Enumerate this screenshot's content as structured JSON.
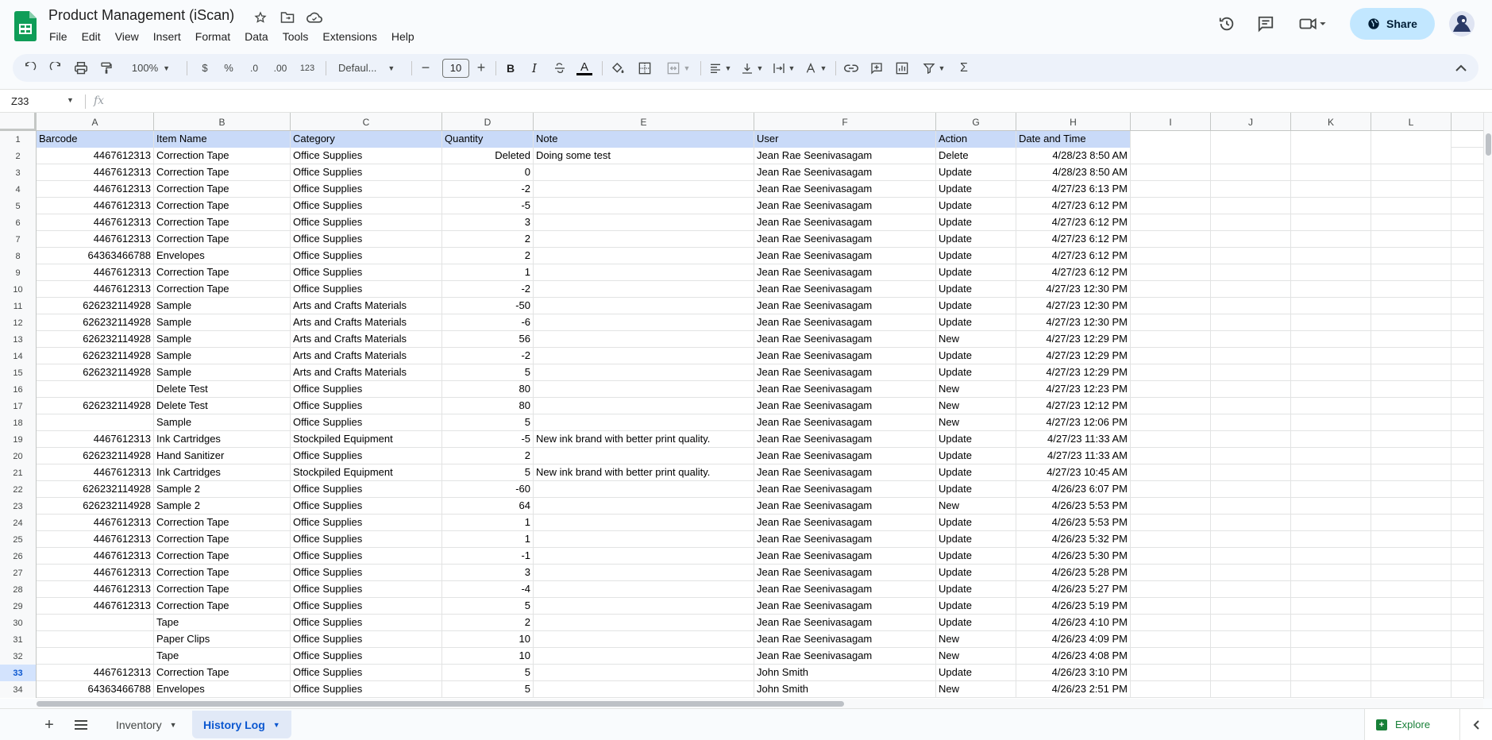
{
  "app": {
    "title": "Product Management (iScan)",
    "menu": [
      "File",
      "Edit",
      "View",
      "Insert",
      "Format",
      "Data",
      "Tools",
      "Extensions",
      "Help"
    ],
    "share_label": "Share",
    "colors": {
      "accent": "#0b57d0",
      "share_bg": "#c2e7ff",
      "header_fill": "#c9daf8",
      "sheets_green": "#188038"
    }
  },
  "toolbar": {
    "zoom": "100%",
    "currency": "$",
    "percent": "%",
    "dec_decrease": ".0",
    "dec_increase": ".00",
    "more_formats": "123",
    "font": "Defaul...",
    "font_size": "10",
    "bold": "B",
    "italic": "I",
    "text_color": "A"
  },
  "formula_bar": {
    "cell_ref": "Z33",
    "fx": "fx",
    "value": ""
  },
  "sheet": {
    "columns": [
      "A",
      "B",
      "C",
      "D",
      "E",
      "F",
      "G",
      "H",
      "I",
      "J",
      "K",
      "L"
    ],
    "header": [
      "Barcode",
      "Item Name",
      "Category",
      "Quantity",
      "Note",
      "User",
      "Action",
      "Date and Time"
    ],
    "selected_row": "33",
    "rows": [
      [
        "1",
        "",
        "",
        "",
        "",
        "",
        "",
        "",
        ""
      ],
      [
        "2",
        "4467612313",
        "Correction Tape",
        "Office Supplies",
        "Deleted",
        "Doing some test",
        "Jean Rae Seenivasagam",
        "Delete",
        "4/28/23 8:50 AM"
      ],
      [
        "3",
        "4467612313",
        "Correction Tape",
        "Office Supplies",
        "0",
        "",
        "Jean Rae Seenivasagam",
        "Update",
        "4/28/23 8:50 AM"
      ],
      [
        "4",
        "4467612313",
        "Correction Tape",
        "Office Supplies",
        "-2",
        "",
        "Jean Rae Seenivasagam",
        "Update",
        "4/27/23 6:13 PM"
      ],
      [
        "5",
        "4467612313",
        "Correction Tape",
        "Office Supplies",
        "-5",
        "",
        "Jean Rae Seenivasagam",
        "Update",
        "4/27/23 6:12 PM"
      ],
      [
        "6",
        "4467612313",
        "Correction Tape",
        "Office Supplies",
        "3",
        "",
        "Jean Rae Seenivasagam",
        "Update",
        "4/27/23 6:12 PM"
      ],
      [
        "7",
        "4467612313",
        "Correction Tape",
        "Office Supplies",
        "2",
        "",
        "Jean Rae Seenivasagam",
        "Update",
        "4/27/23 6:12 PM"
      ],
      [
        "8",
        "64363466788",
        "Envelopes",
        "Office Supplies",
        "2",
        "",
        "Jean Rae Seenivasagam",
        "Update",
        "4/27/23 6:12 PM"
      ],
      [
        "9",
        "4467612313",
        "Correction Tape",
        "Office Supplies",
        "1",
        "",
        "Jean Rae Seenivasagam",
        "Update",
        "4/27/23 6:12 PM"
      ],
      [
        "10",
        "4467612313",
        "Correction Tape",
        "Office Supplies",
        "-2",
        "",
        "Jean Rae Seenivasagam",
        "Update",
        "4/27/23 12:30 PM"
      ],
      [
        "11",
        "626232114928",
        "Sample",
        "Arts and Crafts Materials",
        "-50",
        "",
        "Jean Rae Seenivasagam",
        "Update",
        "4/27/23 12:30 PM"
      ],
      [
        "12",
        "626232114928",
        "Sample",
        "Arts and Crafts Materials",
        "-6",
        "",
        "Jean Rae Seenivasagam",
        "Update",
        "4/27/23 12:30 PM"
      ],
      [
        "13",
        "626232114928",
        "Sample",
        "Arts and Crafts Materials",
        "56",
        "",
        "Jean Rae Seenivasagam",
        "New",
        "4/27/23 12:29 PM"
      ],
      [
        "14",
        "626232114928",
        "Sample",
        "Arts and Crafts Materials",
        "-2",
        "",
        "Jean Rae Seenivasagam",
        "Update",
        "4/27/23 12:29 PM"
      ],
      [
        "15",
        "626232114928",
        "Sample",
        "Arts and Crafts Materials",
        "5",
        "",
        "Jean Rae Seenivasagam",
        "Update",
        "4/27/23 12:29 PM"
      ],
      [
        "16",
        "",
        "Delete Test",
        "Office Supplies",
        "80",
        "",
        "Jean Rae Seenivasagam",
        "New",
        "4/27/23 12:23 PM"
      ],
      [
        "17",
        "626232114928",
        "Delete Test",
        "Office Supplies",
        "80",
        "",
        "Jean Rae Seenivasagam",
        "New",
        "4/27/23 12:12 PM"
      ],
      [
        "18",
        "",
        "Sample",
        "Office Supplies",
        "5",
        "",
        "Jean Rae Seenivasagam",
        "New",
        "4/27/23 12:06 PM"
      ],
      [
        "19",
        "4467612313",
        "Ink Cartridges",
        "Stockpiled Equipment",
        "-5",
        "New ink brand with better print quality.",
        "Jean Rae Seenivasagam",
        "Update",
        "4/27/23 11:33 AM"
      ],
      [
        "20",
        "626232114928",
        "Hand Sanitizer",
        "Office Supplies",
        "2",
        "",
        "Jean Rae Seenivasagam",
        "Update",
        "4/27/23 11:33 AM"
      ],
      [
        "21",
        "4467612313",
        "Ink Cartridges",
        "Stockpiled Equipment",
        "5",
        "New ink brand with better print quality.",
        "Jean Rae Seenivasagam",
        "Update",
        "4/27/23 10:45 AM"
      ],
      [
        "22",
        "626232114928",
        "Sample 2",
        "Office Supplies",
        "-60",
        "",
        "Jean Rae Seenivasagam",
        "Update",
        "4/26/23 6:07 PM"
      ],
      [
        "23",
        "626232114928",
        "Sample 2",
        "Office Supplies",
        "64",
        "",
        "Jean Rae Seenivasagam",
        "New",
        "4/26/23 5:53 PM"
      ],
      [
        "24",
        "4467612313",
        "Correction Tape",
        "Office Supplies",
        "1",
        "",
        "Jean Rae Seenivasagam",
        "Update",
        "4/26/23 5:53 PM"
      ],
      [
        "25",
        "4467612313",
        "Correction Tape",
        "Office Supplies",
        "1",
        "",
        "Jean Rae Seenivasagam",
        "Update",
        "4/26/23 5:32 PM"
      ],
      [
        "26",
        "4467612313",
        "Correction Tape",
        "Office Supplies",
        "-1",
        "",
        "Jean Rae Seenivasagam",
        "Update",
        "4/26/23 5:30 PM"
      ],
      [
        "27",
        "4467612313",
        "Correction Tape",
        "Office Supplies",
        "3",
        "",
        "Jean Rae Seenivasagam",
        "Update",
        "4/26/23 5:28 PM"
      ],
      [
        "28",
        "4467612313",
        "Correction Tape",
        "Office Supplies",
        "-4",
        "",
        "Jean Rae Seenivasagam",
        "Update",
        "4/26/23 5:27 PM"
      ],
      [
        "29",
        "4467612313",
        "Correction Tape",
        "Office Supplies",
        "5",
        "",
        "Jean Rae Seenivasagam",
        "Update",
        "4/26/23 5:19 PM"
      ],
      [
        "30",
        "",
        "Tape",
        "Office Supplies",
        "2",
        "",
        "Jean Rae Seenivasagam",
        "Update",
        "4/26/23 4:10 PM"
      ],
      [
        "31",
        "",
        "Paper Clips",
        "Office Supplies",
        "10",
        "",
        "Jean Rae Seenivasagam",
        "New",
        "4/26/23 4:09 PM"
      ],
      [
        "32",
        "",
        "Tape",
        "Office Supplies",
        "10",
        "",
        "Jean Rae Seenivasagam",
        "New",
        "4/26/23 4:08 PM"
      ],
      [
        "33",
        "4467612313",
        "Correction Tape",
        "Office Supplies",
        "5",
        "",
        "John Smith",
        "Update",
        "4/26/23 3:10 PM"
      ],
      [
        "34",
        "64363466788",
        "Envelopes",
        "Office Supplies",
        "5",
        "",
        "John Smith",
        "New",
        "4/26/23 2:51 PM"
      ]
    ]
  },
  "sheet_tabs": [
    {
      "label": "Inventory",
      "active": false
    },
    {
      "label": "History Log",
      "active": true
    }
  ],
  "explore_label": "Explore"
}
